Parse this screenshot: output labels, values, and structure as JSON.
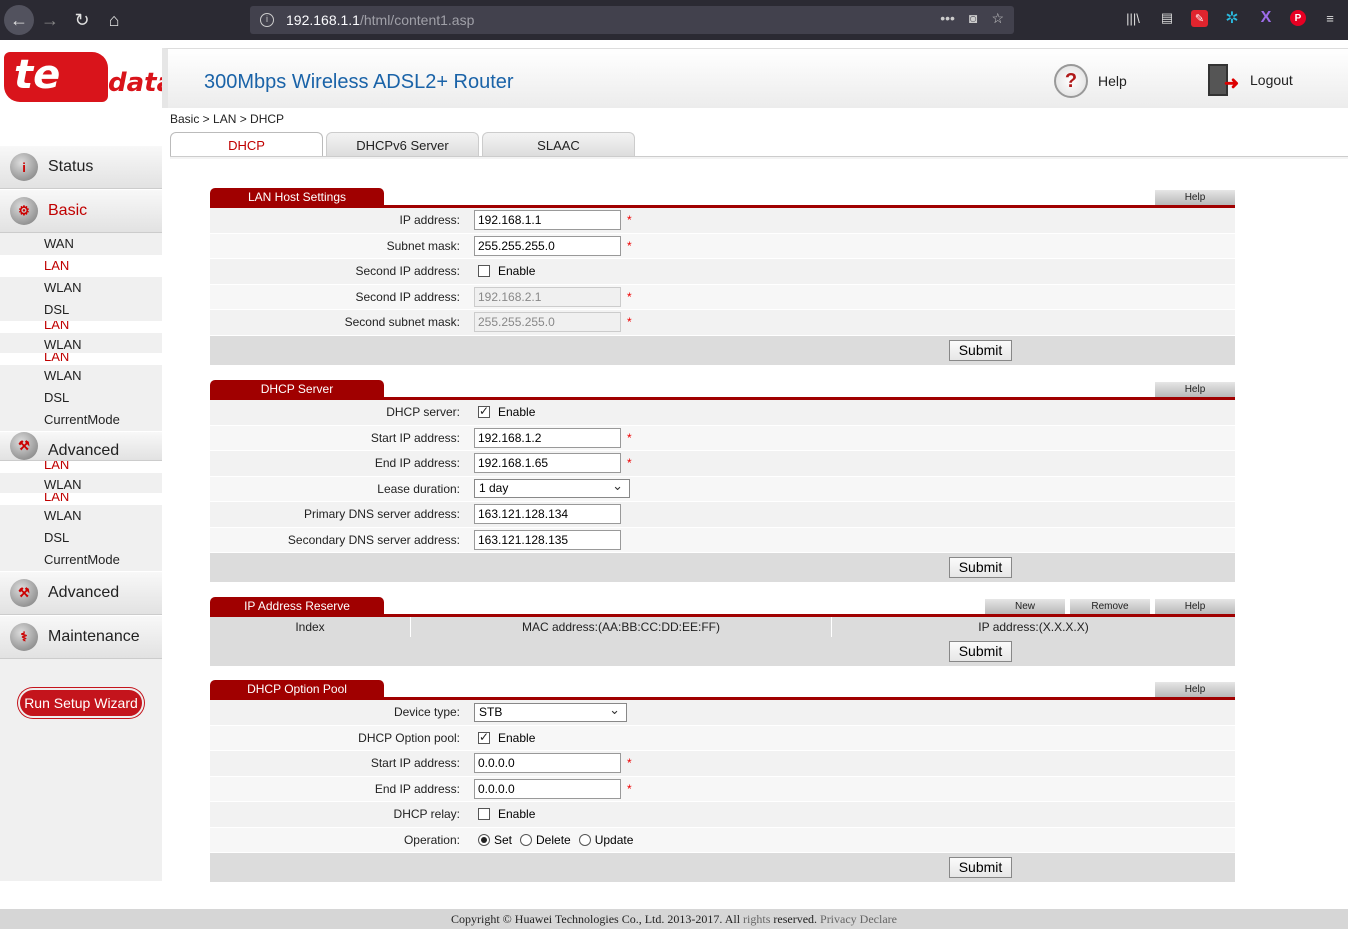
{
  "browser": {
    "url_host": "192.168.1.1",
    "url_path": "/html/content1.asp"
  },
  "brand": {
    "logo_main": "te",
    "logo_sub": "data"
  },
  "header": {
    "title": "300Mbps Wireless ADSL2+ Router",
    "help_label": "Help",
    "logout_label": "Logout"
  },
  "breadcrumb": "Basic > LAN > DHCP",
  "tabs": [
    {
      "label": "DHCP",
      "active": true
    },
    {
      "label": "DHCPv6 Server",
      "active": false
    },
    {
      "label": "SLAAC",
      "active": false
    }
  ],
  "sidebar": {
    "status": "Status",
    "basic": "Basic",
    "basic_items": [
      "WAN",
      "LAN",
      "WLAN",
      "DSL",
      "LAN",
      "WLAN",
      "LAN",
      "WLAN",
      "DSL",
      "CurrentMode"
    ],
    "advanced1": "Advanced",
    "advanced1_items": [
      "LAN",
      "WLAN",
      "LAN",
      "WLAN",
      "DSL",
      "CurrentMode"
    ],
    "advanced2": "Advanced",
    "maintenance": "Maintenance",
    "wizard": "Run Setup Wizard"
  },
  "lan_host": {
    "title": "LAN Host Settings",
    "help": "Help",
    "ip_label": "IP address:",
    "ip_value": "192.168.1.1",
    "mask_label": "Subnet mask:",
    "mask_value": "255.255.255.0",
    "second_ip_label": "Second IP address:",
    "enable_label": "Enable",
    "second_ip_addr_label": "Second IP address:",
    "second_ip_value": "192.168.2.1",
    "second_mask_label": "Second subnet mask:",
    "second_mask_value": "255.255.255.0",
    "submit": "Submit"
  },
  "dhcp_server": {
    "title": "DHCP Server",
    "help": "Help",
    "server_label": "DHCP server:",
    "enable_label": "Enable",
    "start_label": "Start IP address:",
    "start_value": "192.168.1.2",
    "end_label": "End IP address:",
    "end_value": "192.168.1.65",
    "lease_label": "Lease duration:",
    "lease_value": "1 day",
    "dns1_label": "Primary DNS server address:",
    "dns1_value": "163.121.128.134",
    "dns2_label": "Secondary DNS server address:",
    "dns2_value": "163.121.128.135",
    "submit": "Submit"
  },
  "ip_reserve": {
    "title": "IP Address Reserve",
    "new": "New",
    "remove": "Remove",
    "help": "Help",
    "col_index": "Index",
    "col_mac": "MAC address:(AA:BB:CC:DD:EE:FF)",
    "col_ip": "IP address:(X.X.X.X)",
    "submit": "Submit"
  },
  "option_pool": {
    "title": "DHCP Option Pool",
    "help": "Help",
    "device_label": "Device type:",
    "device_value": "STB",
    "pool_label": "DHCP Option pool:",
    "enable_label": "Enable",
    "start_label": "Start IP address:",
    "start_value": "0.0.0.0",
    "end_label": "End IP address:",
    "end_value": "0.0.0.0",
    "relay_label": "DHCP relay:",
    "relay_enable": "Enable",
    "op_label": "Operation:",
    "op_set": "Set",
    "op_delete": "Delete",
    "op_update": "Update",
    "submit": "Submit"
  },
  "footer": {
    "copyright_a": "Copyright © Huawei Technologies Co., Ltd. 2013-2017. All ",
    "copyright_b": "rights",
    "copyright_c": " reserved. ",
    "privacy": "Privacy Declare"
  },
  "colors": {
    "brand_red": "#a00000",
    "title_blue": "#1a63a8",
    "active_red": "#c00000"
  }
}
